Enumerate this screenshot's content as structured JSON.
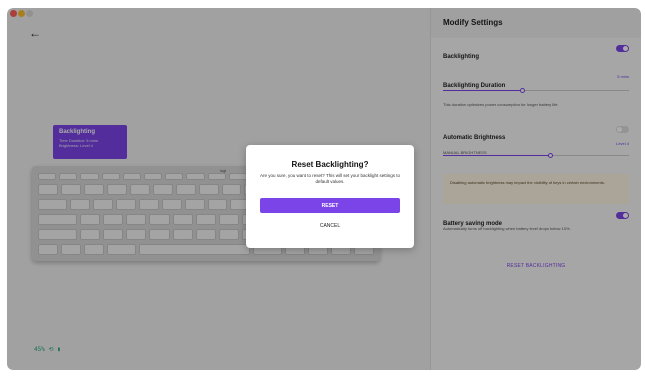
{
  "window": {
    "back_icon": "arrow-left-icon",
    "back_glyph": "←"
  },
  "keyboard": {
    "logo": "logi"
  },
  "tooltip": {
    "title": "Backlighting",
    "line1": "Time Duration: 5 mins",
    "line2": "Brightness: Level 4"
  },
  "status_mini": "45% ⟲ ▮",
  "panel": {
    "title": "Modify Settings",
    "backlighting": {
      "label": "Backlighting",
      "enabled": true
    },
    "duration": {
      "label": "Backlighting Duration",
      "value": "5 mins",
      "position": 0.43,
      "note": "This duration optimizes power consumption for longer battery life."
    },
    "auto_brightness": {
      "label": "Automatic Brightness",
      "enabled": false,
      "manual_label": "MANUAL BRIGHTNESS",
      "level": "Level 4",
      "position": 0.58
    },
    "warning": "Disabling automatic brightness may impact the visibility of keys in certain environments.",
    "battery": {
      "label": "Battery saving mode",
      "enabled": true,
      "note": "Automatically turns off backlighting when battery level drops below 10%."
    },
    "reset_link": "RESET BACKLIGHTING"
  },
  "modal": {
    "title": "Reset Backlighting?",
    "message": "Are you sure, you want to reset? This will set your backlight settings to default values.",
    "reset_label": "RESET",
    "cancel_label": "CANCEL"
  },
  "colors": {
    "accent": "#7b44e8",
    "overlay": "rgba(0,0,0,0.33)"
  }
}
